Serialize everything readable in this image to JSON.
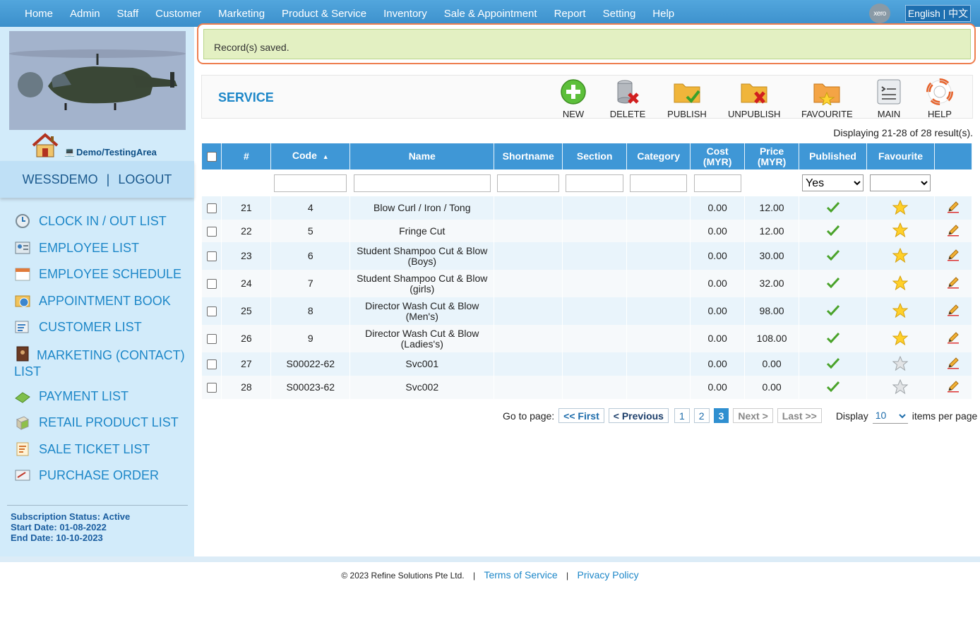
{
  "nav": {
    "items": [
      "Home",
      "Admin",
      "Staff",
      "Customer",
      "Marketing",
      "Product & Service",
      "Inventory",
      "Sale & Appointment",
      "Report",
      "Setting",
      "Help"
    ],
    "xero": "xero",
    "language": "English | 中文"
  },
  "sidebar": {
    "area": "Demo/TestingArea",
    "user": "WESSDEMO",
    "divider": "|",
    "logout": "LOGOUT",
    "items": [
      {
        "label": "CLOCK IN / OUT LIST",
        "icon": "clock-icon"
      },
      {
        "label": "EMPLOYEE LIST",
        "icon": "employee-list-icon"
      },
      {
        "label": "EMPLOYEE SCHEDULE",
        "icon": "calendar-icon"
      },
      {
        "label": "APPOINTMENT BOOK",
        "icon": "appointment-book-icon"
      },
      {
        "label": "CUSTOMER LIST",
        "icon": "customer-list-icon"
      },
      {
        "label": "MARKETING (CONTACT) LIST",
        "icon": "contact-book-icon"
      },
      {
        "label": "PAYMENT LIST",
        "icon": "money-icon"
      },
      {
        "label": "RETAIL PRODUCT LIST",
        "icon": "product-box-icon"
      },
      {
        "label": "SALE TICKET LIST",
        "icon": "ticket-icon"
      },
      {
        "label": "PURCHASE ORDER",
        "icon": "purchase-order-icon"
      }
    ],
    "subscription": {
      "status": "Subscription Status: Active",
      "start": "Start Date: 01-08-2022",
      "end": "End Date: 10-10-2023"
    }
  },
  "alert": {
    "message": "Record(s) saved."
  },
  "toolbar": {
    "title": "SERVICE",
    "buttons": [
      "NEW",
      "DELETE",
      "PUBLISH",
      "UNPUBLISH",
      "FAVOURITE",
      "MAIN",
      "HELP"
    ]
  },
  "results": "Displaying 21-28 of 28 result(s).",
  "table": {
    "headers": {
      "num": "#",
      "code": "Code",
      "name": "Name",
      "shortname": "Shortname",
      "section": "Section",
      "category": "Category",
      "cost": "Cost",
      "cost_unit": "(MYR)",
      "price": "Price",
      "price_unit": "(MYR)",
      "published": "Published",
      "favourite": "Favourite"
    },
    "filters": {
      "published": "Yes",
      "favourite": ""
    },
    "rows": [
      {
        "num": "21",
        "code": "4",
        "name1": "Blow Curl / Iron / Tong",
        "name2": "",
        "cost": "0.00",
        "price": "12.00",
        "fav": true
      },
      {
        "num": "22",
        "code": "5",
        "name1": "Fringe Cut",
        "name2": "",
        "cost": "0.00",
        "price": "12.00",
        "fav": true
      },
      {
        "num": "23",
        "code": "6",
        "name1": "Student Shampoo Cut & Blow",
        "name2": "(Boys)",
        "cost": "0.00",
        "price": "30.00",
        "fav": true
      },
      {
        "num": "24",
        "code": "7",
        "name1": "Student Shampoo Cut & Blow",
        "name2": "(girls)",
        "cost": "0.00",
        "price": "32.00",
        "fav": true
      },
      {
        "num": "25",
        "code": "8",
        "name1": "Director Wash Cut & Blow",
        "name2": "(Men's)",
        "cost": "0.00",
        "price": "98.00",
        "fav": true
      },
      {
        "num": "26",
        "code": "9",
        "name1": "Director Wash Cut & Blow",
        "name2": "(Ladies's)",
        "cost": "0.00",
        "price": "108.00",
        "fav": true
      },
      {
        "num": "27",
        "code": "S00022-62",
        "name1": "Svc001",
        "name2": "",
        "cost": "0.00",
        "price": "0.00",
        "fav": false
      },
      {
        "num": "28",
        "code": "S00023-62",
        "name1": "Svc002",
        "name2": "",
        "cost": "0.00",
        "price": "0.00",
        "fav": false
      }
    ]
  },
  "pager": {
    "goto": "Go to page:",
    "first": "<< First",
    "previous": "< Previous",
    "pages": [
      "1",
      "2",
      "3"
    ],
    "current": "3",
    "next": "Next >",
    "last": "Last >>",
    "display": "Display",
    "per_page": "10",
    "items_label": "items per page"
  },
  "footer": {
    "copyright": "© 2023 Refine Solutions Pte Ltd.",
    "terms": "Terms of Service",
    "privacy": "Privacy Policy",
    "sep": "|"
  },
  "colors": {
    "nav": "#3f97d6",
    "accent": "#1d87c8",
    "sidebar": "#d2ebfa",
    "alert": "#e3f0c2",
    "alert_border": "#ee7f50"
  }
}
